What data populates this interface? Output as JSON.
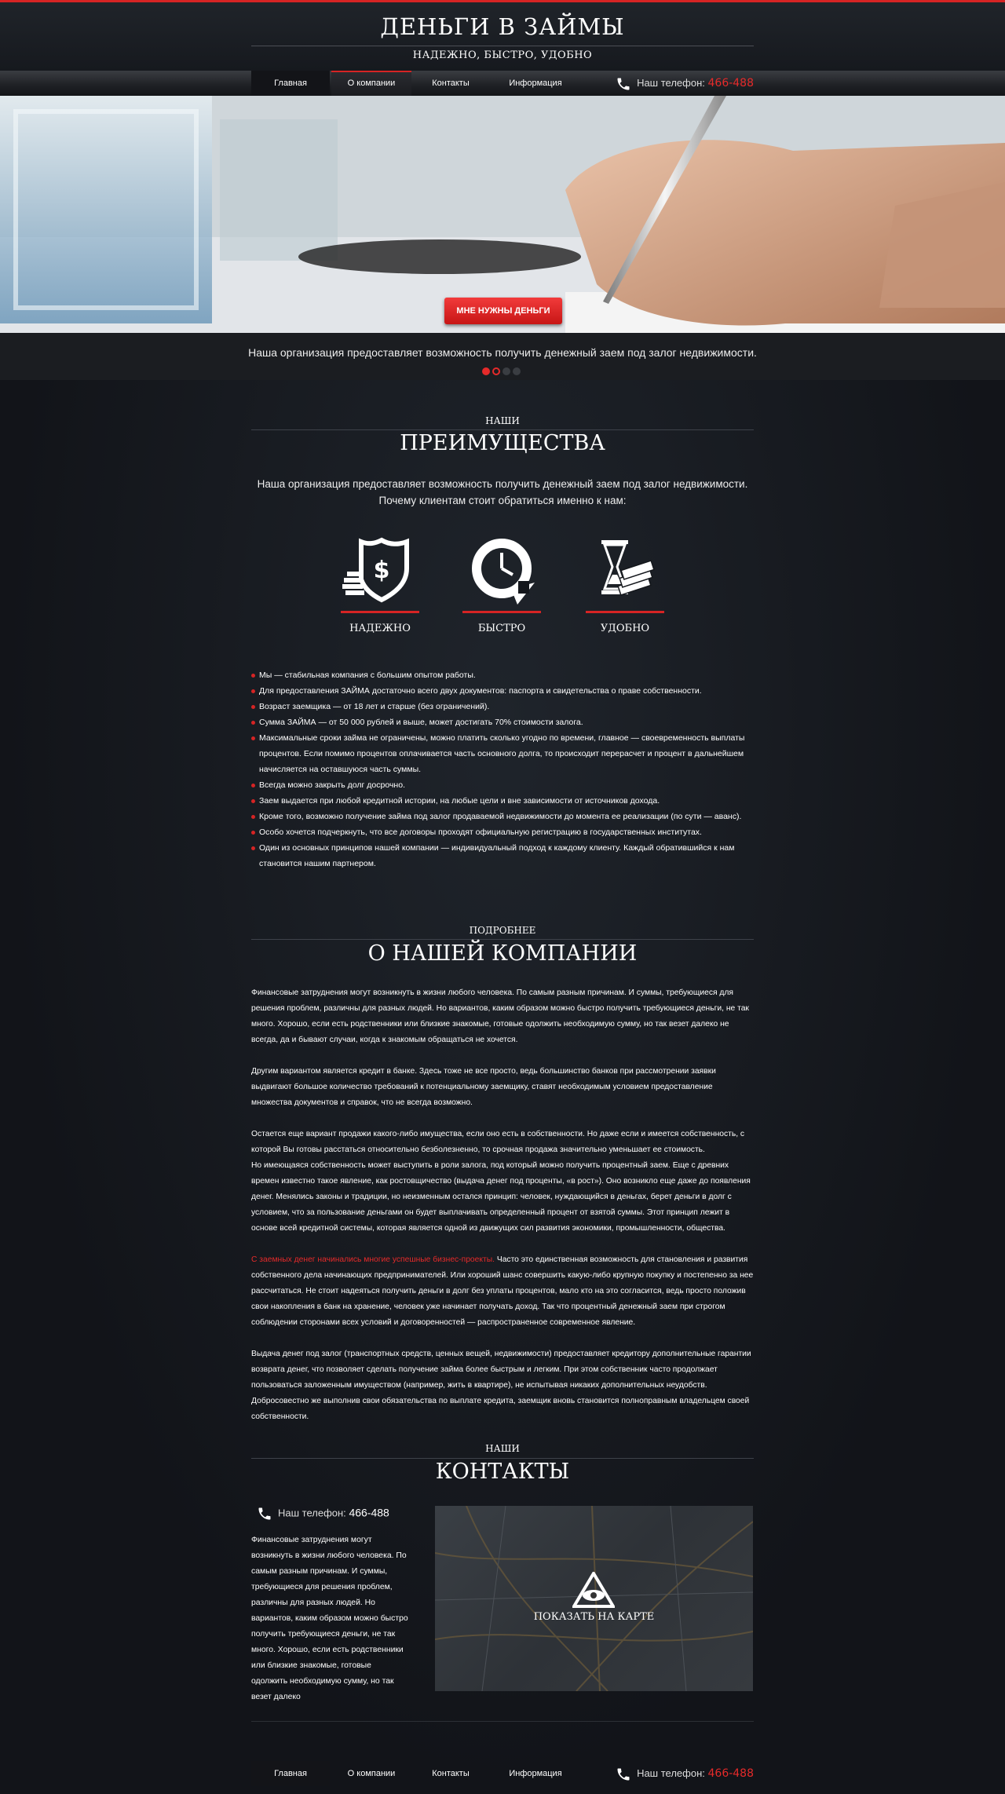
{
  "header": {
    "title": "ДЕНЬГИ В ЗАЙМЫ",
    "subtitle": "НАДЕЖНО, БЫСТРО, УДОБНО"
  },
  "nav": {
    "items": [
      {
        "label": "Главная"
      },
      {
        "label": "О компании"
      },
      {
        "label": "Контакты"
      },
      {
        "label": "Информация"
      }
    ],
    "phone_label": "Наш телефон:",
    "phone_number": "466-488"
  },
  "hero": {
    "cta_label": "МНЕ НУЖНЫ ДЕНЬГИ",
    "caption": "Наша организация предоставляет возможность получить денежный заем под залог недвижимости."
  },
  "advantages": {
    "kicker": "НАШИ",
    "title": "ПРЕИМУЩЕСТВА",
    "intro_line1": "Наша организация предоставляет возможность получить денежный заем под залог недвижимости.",
    "intro_line2": "Почему клиентам стоит обратиться именно к нам:",
    "features": [
      {
        "label": "НАДЕЖНО",
        "icon": "shield-dollar-icon"
      },
      {
        "label": "БЫСТРО",
        "icon": "clock-arrow-icon"
      },
      {
        "label": "УДОБНО",
        "icon": "hourglass-money-icon"
      }
    ],
    "bullets": [
      "Мы — стабильная компания с большим опытом работы.",
      "Для предоставления ЗАЙМА достаточно всего двух документов: паспорта и свидетельства о праве собственности.",
      "Возраст заемщика — от 18 лет и старше (без ограничений).",
      "Сумма ЗАЙМА — от 50 000 рублей и выше, может достигать 70% стоимости залога.",
      "Максимальные сроки займа не ограничены, можно платить сколько угодно по времени, главное — своевременность выплаты процентов. Если помимо процентов оплачивается часть основного долга, то происходит перерасчет и процент в дальнейшем начисляется на оставшуюся часть суммы.",
      "Всегда можно закрыть долг досрочно.",
      "Заем выдается при любой кредитной истории, на любые цели и вне зависимости от источников дохода.",
      "Кроме того, возможно получение займа под залог продаваемой недвижимости до момента ее реализации (по сути — аванс).",
      "Особо хочется подчеркнуть, что все договоры проходят официальную регистрацию в государственных институтах.",
      "Один из основных принципов нашей компании — индивидуальный подход к каждому клиенту. Каждый обратившийся к нам становится нашим партнером."
    ]
  },
  "about": {
    "kicker": "ПОДРОБНЕЕ",
    "title": "О НАШЕЙ КОМПАНИИ",
    "p1": "Финансовые затруднения могут возникнуть в жизни любого человека. По самым разным причинам. И суммы, требующиеся для решения проблем, различны для разных людей. Но вариантов, каким образом можно быстро получить требующиеся деньги, не так много. Хорошо, если есть родственники или близкие знакомые, готовые одолжить необходимую сумму, но так везет далеко не всегда, да и бывают случаи, когда к знакомым обращаться не хочется.",
    "p2": "Другим вариантом является кредит в банке. Здесь тоже не все просто, ведь большинство банков при рассмотрении заявки выдвигают большое количество требований к потенциальному заемщику, ставят необходимым условием предоставление множества документов и справок, что не всегда возможно.",
    "p3": "Остается еще вариант продажи какого-либо имущества, если оно есть в собственности. Но даже если и имеется собственность, с которой Вы готовы расстаться относительно безболезненно, то срочная продажа значительно уменьшает ее стоимость.",
    "p3b": "Но имеющаяся собственность может выступить в роли залога, под который можно получить процентный заем. Еще с древних времен известно такое явление, как ростовщичество (выдача денег под проценты, «в рост»). Оно возникло еще даже до появления денег. Менялись законы и традиции, но неизменным остался принцип: человек, нуждающийся в деньгах, берет деньги в долг с условием, что за пользование деньгами он будет выплачивать определенный процент от взятой суммы. Этот принцип лежит в основе всей кредитной системы, которая является одной из движущих сил развития экономики, промышленности, общества.",
    "p4_red": "С заемных денег начинались многие успешные бизнес-проекты.",
    "p4": " Часто это единственная возможность для становления и развития собственного дела начинающих предпринимателей. Или хороший шанс совершить какую-либо крупную покупку и постепенно за нее рассчитаться. Не стоит надеяться получить деньги в долг без уплаты процентов, мало кто на это согласится, ведь просто положив свои накопления в банк на хранение, человек уже начинает получать доход. Так что процентный денежный заем при строгом соблюдении сторонами всех условий и договоренностей — распространенное современное явление.",
    "p5": "Выдача денег под залог (транспортных средств, ценных вещей, недвижимости) предоставляет кредитору дополнительные гарантии возврата денег, что позволяет сделать получение займа более быстрым и легким. При этом собственник часто продолжает пользоваться заложенным имуществом (например, жить в квартире), не испытывая никаких дополнительных неудобств. Добросовестно же выполнив свои обязательства по выплате кредита, заемщик вновь становится полноправным владельцем своей собственности."
  },
  "contacts": {
    "kicker": "НАШИ",
    "title": "КОНТАКТЫ",
    "phone_label": "Наш телефон:",
    "phone_number": "466-488",
    "text": "Финансовые затруднения могут возникнуть в жизни любого человека. По самым разным причинам. И суммы, требующиеся для решения проблем, различны для разных людей. Но вариантов, каким образом можно быстро получить требующиеся деньги, не так много. Хорошо, если есть родственники или близкие знакомые, готовые одолжить необходимую сумму, но так везет далеко",
    "map_label": "ПОКАЗАТЬ НА КАРТЕ"
  },
  "colors": {
    "accent": "#d62424",
    "background": "#14171c"
  }
}
